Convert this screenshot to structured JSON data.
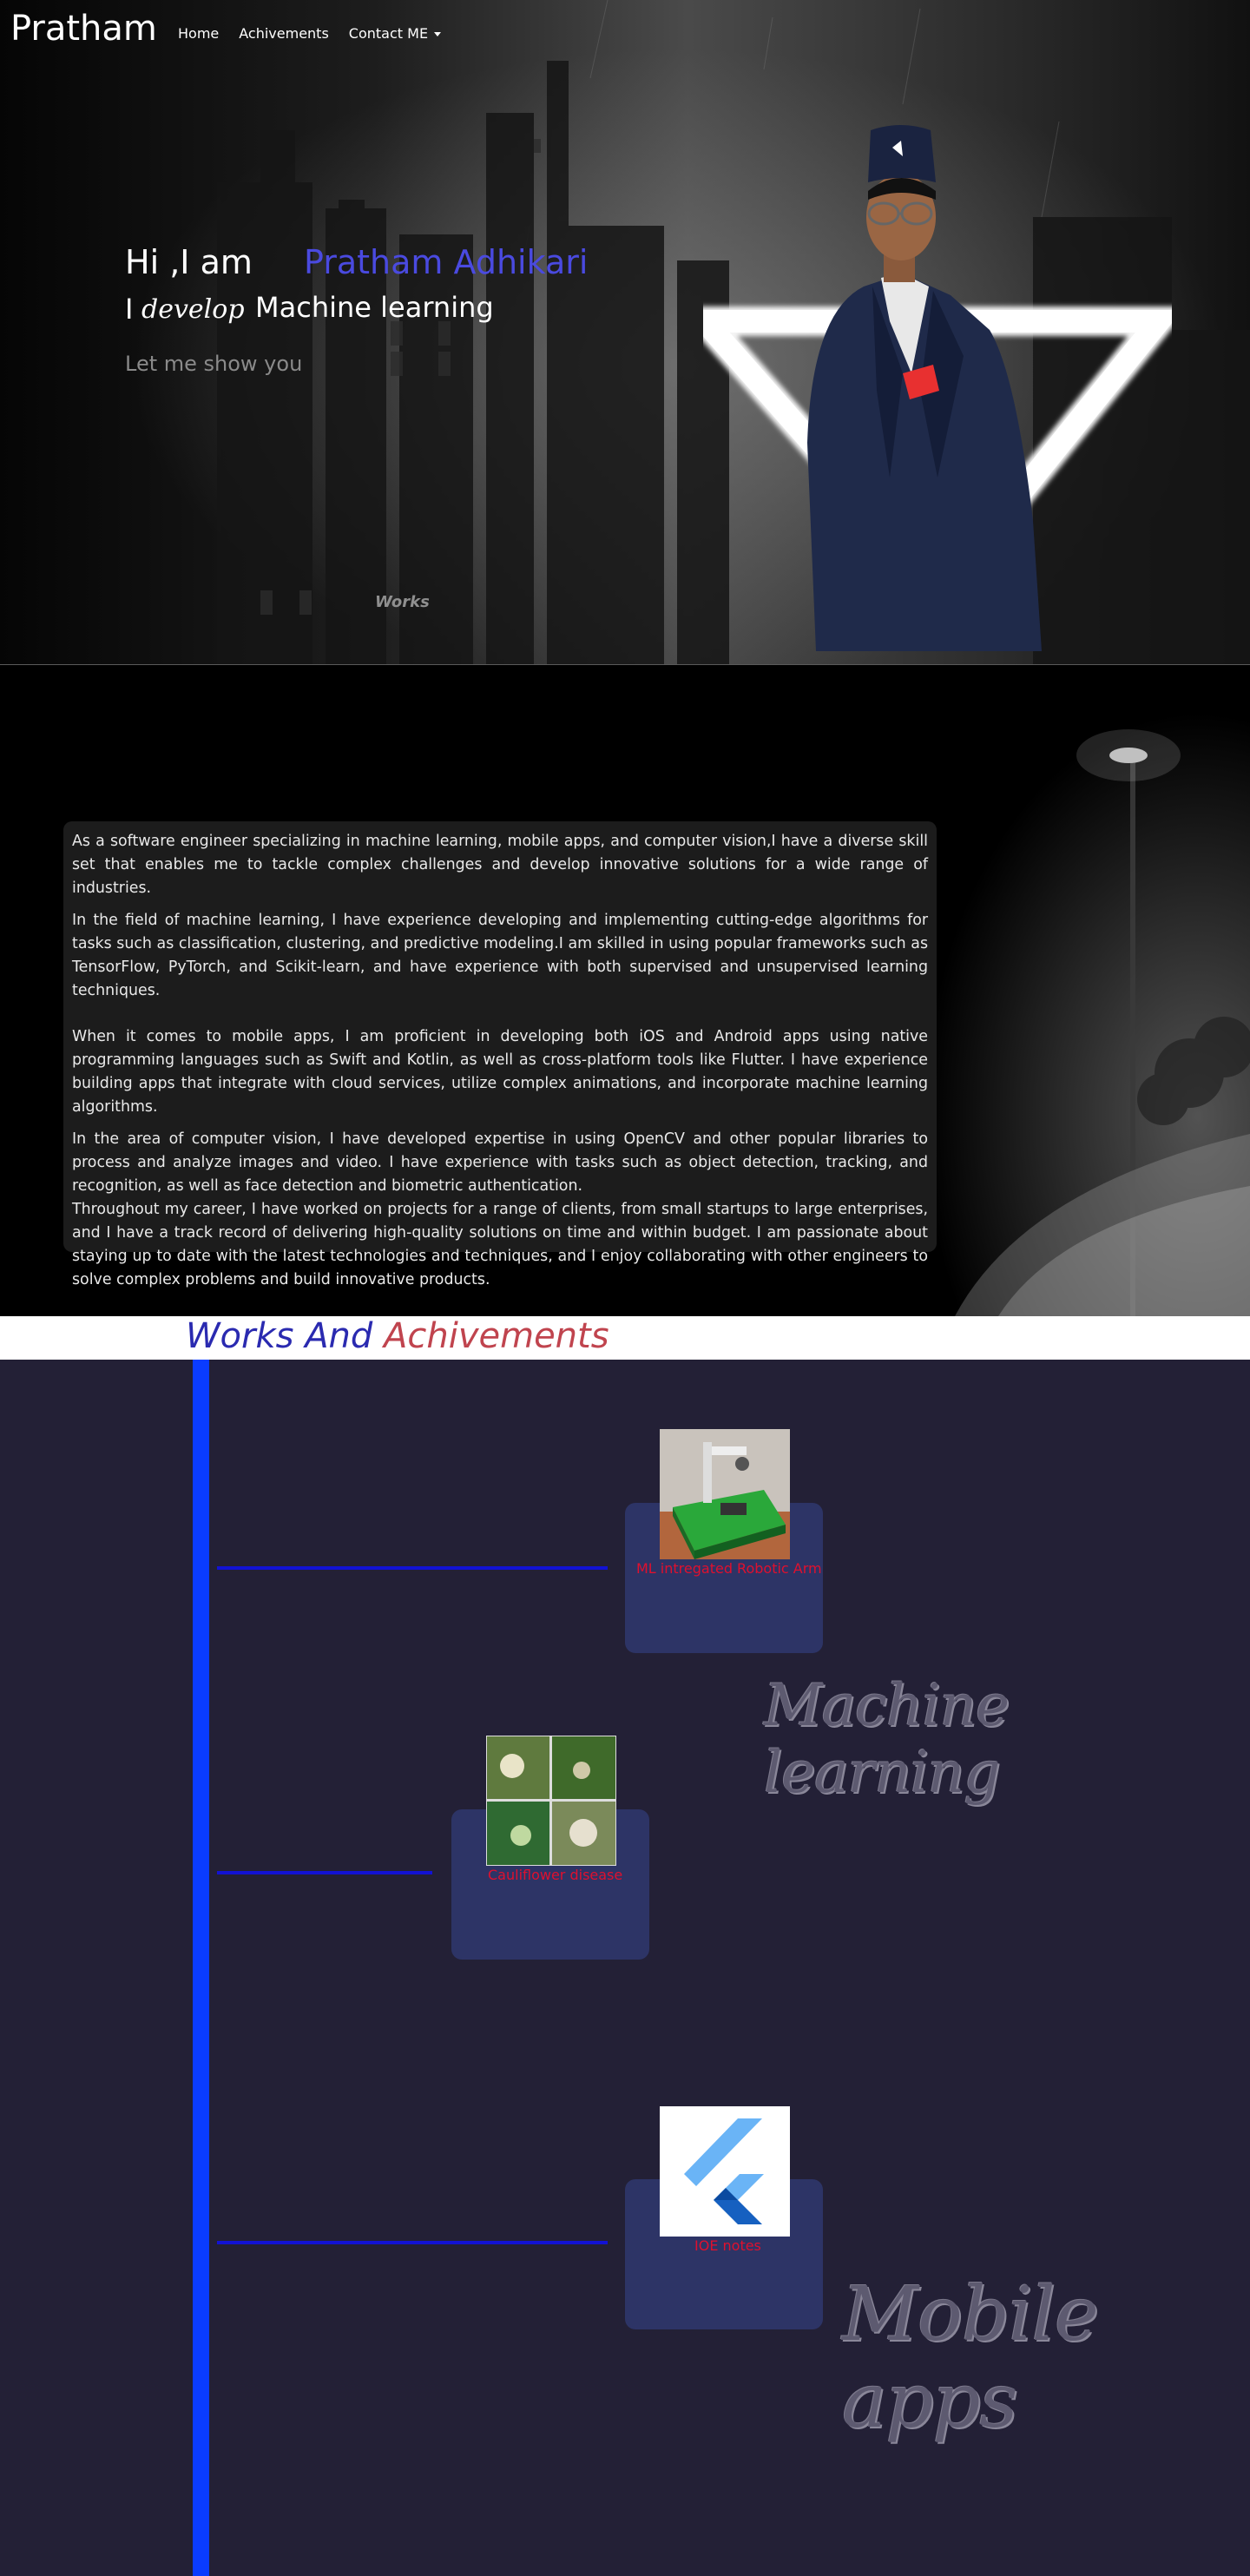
{
  "nav": {
    "brand": "Pratham",
    "links": [
      "Home",
      "Achivements",
      "Contact ME"
    ]
  },
  "hero": {
    "greeting": "Hi ,I am",
    "name": "Pratham Adhikari",
    "develop_i": "I",
    "develop_word": "develop",
    "develop_subject": "Machine learning",
    "tagline": "Let me show you",
    "works_link": "Works"
  },
  "about": {
    "paragraphs": [
      "As a software engineer specializing in machine learning, mobile apps, and computer vision,I have a diverse skill set that enables me to tackle complex challenges and develop innovative solutions for a wide range of industries.",
      "In the field of machine learning, I have experience developing and implementing cutting-edge algorithms for tasks such as classification, clustering, and predictive modeling.I am skilled in using popular frameworks such as TensorFlow, PyTorch, and Scikit-learn, and have experience with both supervised and unsupervised learning techniques.",
      "When it comes to mobile apps, I am proficient in developing both iOS and Android apps using native programming languages such as Swift and Kotlin, as well as cross-platform tools like Flutter. I have experience building apps that integrate with cloud services, utilize complex animations, and incorporate machine learning algorithms.",
      "In the area of computer vision, I have developed expertise in using OpenCV and other popular libraries to process and analyze images and video. I have experience with tasks such as object detection, tracking, and recognition, as well as face detection and biometric authentication.",
      "Throughout my career, I have worked on projects for a range of clients, from small startups to large enterprises, and I have a track record of delivering high-quality solutions on time and within budget. I am passionate about staying up to date with the latest technologies and techniques, and I enjoy collaborating with other engineers to solve complex problems and build innovative products."
    ]
  },
  "works": {
    "title_part1": "Works And",
    "title_part2": "Achivements",
    "items": [
      {
        "label": "ML intregated Robotic Arm",
        "icon": "robotic-arm-photo"
      },
      {
        "label": "Cauliflower disease",
        "icon": "cauliflower-collage-photo"
      },
      {
        "label": "IOE notes",
        "icon": "flutter-logo"
      }
    ],
    "categories": [
      "Machine learning",
      "Mobile apps"
    ]
  },
  "colors": {
    "name_blue": "#4a4ae0",
    "timeline_blue": "#0a3cff",
    "label_red": "#e0102e",
    "title_blue": "#2a2ab0",
    "title_red": "#c0444e"
  }
}
